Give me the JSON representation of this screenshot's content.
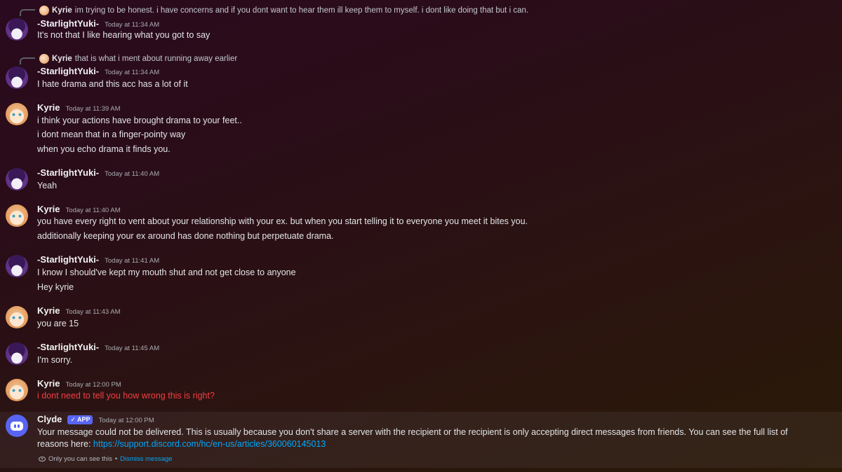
{
  "messages": [
    {
      "author": "-StarlightYuki-",
      "timestamp": "Today at 11:34 AM",
      "avatar": "starlight-avatar",
      "reply": {
        "author": "Kyrie",
        "text": "im trying to be honest. i have concerns and if you dont want to hear them ill keep them to myself. i dont like doing that but i can."
      },
      "lines": [
        "It's not that I like hearing what you got to say"
      ]
    },
    {
      "author": "-StarlightYuki-",
      "timestamp": "Today at 11:34 AM",
      "avatar": "starlight-avatar",
      "reply": {
        "author": "Kyrie",
        "text": "that is what i ment about running away earlier"
      },
      "lines": [
        "I hate drama and this acc has a lot of it"
      ]
    },
    {
      "author": "Kyrie",
      "timestamp": "Today at 11:39 AM",
      "avatar": "kyrie-avatar",
      "lines": [
        "i think your actions have brought drama to your feet..",
        "i dont mean that in a finger-pointy way",
        "when you echo drama it finds you."
      ]
    },
    {
      "author": "-StarlightYuki-",
      "timestamp": "Today at 11:40 AM",
      "avatar": "starlight-avatar",
      "lines": [
        "Yeah"
      ]
    },
    {
      "author": "Kyrie",
      "timestamp": "Today at 11:40 AM",
      "avatar": "kyrie-avatar",
      "lines": [
        "you have every right to vent about your relationship with your ex. but when you start telling it to everyone you meet it bites you.",
        "additionally keeping your ex around has done nothing but perpetuate drama."
      ]
    },
    {
      "author": "-StarlightYuki-",
      "timestamp": "Today at 11:41 AM",
      "avatar": "starlight-avatar",
      "lines": [
        "I know I should've kept my mouth shut and not get close to anyone",
        "Hey kyrie"
      ]
    },
    {
      "author": "Kyrie",
      "timestamp": "Today at 11:43 AM",
      "avatar": "kyrie-avatar",
      "lines": [
        "you are 15"
      ]
    },
    {
      "author": "-StarlightYuki-",
      "timestamp": "Today at 11:45 AM",
      "avatar": "starlight-avatar",
      "lines": [
        "I'm sorry."
      ]
    },
    {
      "author": "Kyrie",
      "timestamp": "Today at 12:00 PM",
      "avatar": "kyrie-avatar",
      "lines": [
        "i dont need to tell you how wrong this is right?"
      ],
      "failed": true
    }
  ],
  "clyde": {
    "author": "Clyde",
    "badge": "APP",
    "badge_icon": "checkmark-icon",
    "timestamp": "Today at 12:00 PM",
    "text": "Your message could not be delivered. This is usually because you don't share a server with the recipient or the recipient is only accepting direct messages from friends. You can see the full list of reasons here: ",
    "link": "https://support.discord.com/hc/en-us/articles/360060145013",
    "ephemeral_note": "Only you can see this",
    "separator": "•",
    "dismiss_label": "Dismiss message"
  },
  "colors": {
    "error_text": "#f23f42",
    "link": "#00a8fc",
    "app_badge": "#5865f2"
  }
}
